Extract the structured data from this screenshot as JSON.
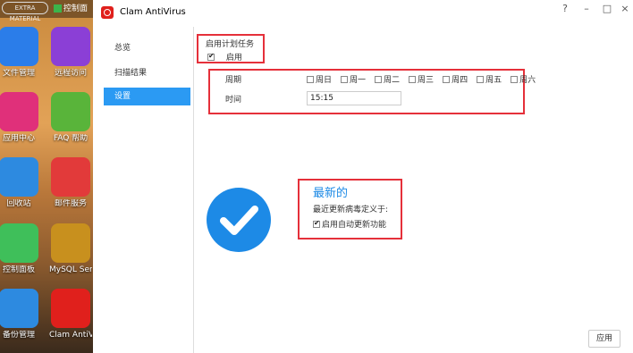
{
  "desktop": {
    "logo": "EXTRA MATERIAL",
    "control_label": "控制面",
    "apps": [
      {
        "label": "文件管理",
        "icon": "folder-icon",
        "color": "#2b7de9"
      },
      {
        "label": "远程访问",
        "icon": "cloud-icon",
        "color": "#8b3fd6"
      },
      {
        "label": "应用中心",
        "icon": "shopping-bag-icon",
        "color": "#e0307a"
      },
      {
        "label": "FAQ 帮助",
        "icon": "question-icon",
        "color": "#59b43a"
      },
      {
        "label": "回收站",
        "icon": "recycle-bin-icon",
        "color": "#2d8ae0"
      },
      {
        "label": "邮件服务",
        "icon": "mail-icon",
        "color": "#e23a3a"
      },
      {
        "label": "控制面板",
        "icon": "sliders-icon",
        "color": "#3fbf5a"
      },
      {
        "label": "MySQL Server",
        "icon": "mariadb-icon",
        "color": "#c8901e"
      },
      {
        "label": "备份管理",
        "icon": "backup-clock-icon",
        "color": "#2d8ae0"
      },
      {
        "label": "Clam AntiVirus",
        "icon": "clam-icon",
        "color": "#e0201c"
      }
    ]
  },
  "window": {
    "title": "Clam AntiVirus",
    "controls": [
      "?",
      "–",
      "□",
      "×"
    ]
  },
  "sidebar": {
    "items": [
      {
        "label": "总览"
      },
      {
        "label": "扫描结果"
      },
      {
        "label": "设置"
      }
    ],
    "active_index": 2
  },
  "schedule": {
    "section_label": "启用计划任务",
    "enable_label": "启用",
    "enable_checked": true,
    "cycle_label": "周期",
    "days": [
      "周日",
      "周一",
      "周二",
      "周三",
      "周四",
      "周五",
      "周六"
    ],
    "time_label": "时间",
    "time_value": "15:15"
  },
  "status": {
    "title": "最新的",
    "subtitle": "最近更新病毒定义于:",
    "auto_update_label": "启用自动更新功能",
    "auto_update_checked": true,
    "accent": "#1d8ae6"
  },
  "footer": {
    "apply_label": "应用"
  },
  "colors": {
    "highlight_box": "#e5303a",
    "active_nav": "#2b9af3"
  }
}
